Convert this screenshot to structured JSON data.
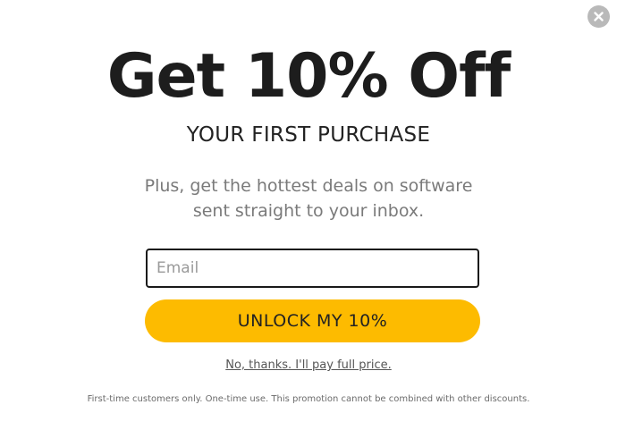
{
  "popup": {
    "close_icon": "close-x-icon",
    "headline": "Get 10% Off",
    "subheadline": "YOUR FIRST PURCHASE",
    "body_line1": "Plus, get the hottest deals on software",
    "body_line2": "sent straight to your inbox.",
    "email": {
      "placeholder": "Email",
      "value": ""
    },
    "cta_label": "UNLOCK MY 10%",
    "decline_label": "No, thanks. I'll pay full price.",
    "disclaimer": "First-time customers only. One-time use. This promotion cannot be combined with other discounts.",
    "colors": {
      "accent": "#fdbb00",
      "headline": "#1d1d1d",
      "body": "#7a7a7a",
      "close_bg": "#b9b9b9"
    }
  }
}
